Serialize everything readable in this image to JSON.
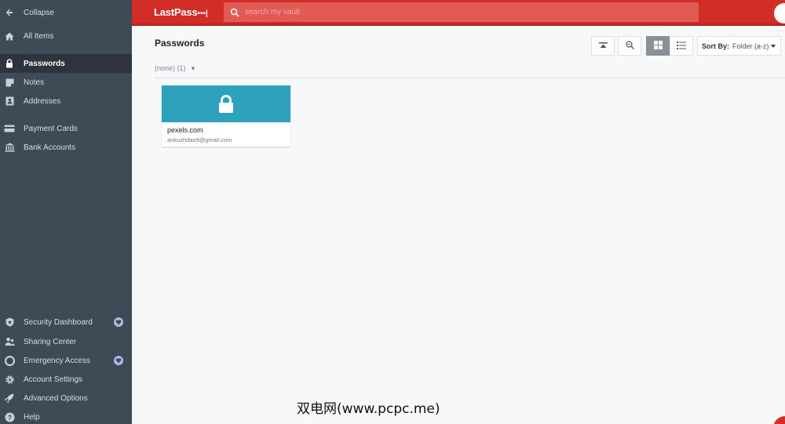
{
  "header": {
    "logo_text": "LastPass",
    "logo_dots": "•••|",
    "search_placeholder": "search my vault"
  },
  "sidebar": {
    "collapse": "Collapse",
    "items": [
      {
        "label": "All Items",
        "icon": "home-icon"
      },
      {
        "label": "Passwords",
        "icon": "lock-icon",
        "active": true
      },
      {
        "label": "Notes",
        "icon": "note-icon"
      },
      {
        "label": "Addresses",
        "icon": "address-icon"
      },
      {
        "label": "Payment Cards",
        "icon": "card-icon"
      },
      {
        "label": "Bank Accounts",
        "icon": "bank-icon"
      }
    ],
    "bottom_items": [
      {
        "label": "Security Dashboard",
        "icon": "shield-icon",
        "premium": true
      },
      {
        "label": "Sharing Center",
        "icon": "share-icon"
      },
      {
        "label": "Emergency Access",
        "icon": "lifebuoy-icon",
        "premium": true
      },
      {
        "label": "Account Settings",
        "icon": "gear-icon"
      },
      {
        "label": "Advanced Options",
        "icon": "rocket-icon"
      },
      {
        "label": "Help",
        "icon": "help-icon"
      }
    ]
  },
  "main": {
    "title": "Passwords",
    "sort_label": "Sort By:",
    "sort_value": "Folder (a-z)",
    "folder_label": "(none) (1)",
    "folder_caret": "▼",
    "cards": [
      {
        "name": "pexels.com",
        "username": "ankushdas9@gmail.com",
        "color": "#2ea1bc"
      }
    ]
  },
  "watermark": "双电网(www.pcpc.me)",
  "colors": {
    "brand_red": "#d32d27",
    "sidebar_bg": "#3e4a56",
    "card_teal": "#2ea1bc"
  }
}
